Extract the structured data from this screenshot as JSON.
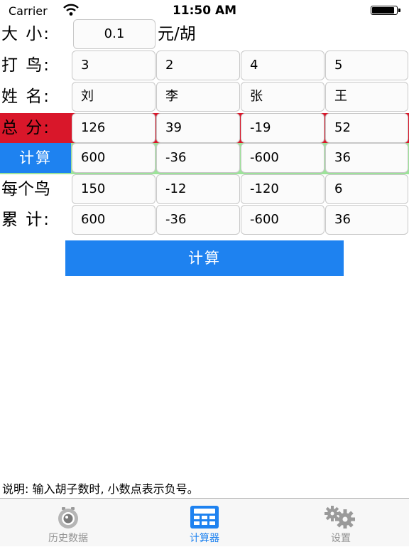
{
  "status_bar": {
    "carrier": "Carrier",
    "time": "11:50 AM",
    "battery_level": 0.9
  },
  "size_row": {
    "label": "大 小:",
    "value": "0.1",
    "unit": "元/胡"
  },
  "bird_row": {
    "label": "打 鸟:",
    "values": [
      "3",
      "2",
      "4",
      "5"
    ]
  },
  "name_row": {
    "label": "姓 名:",
    "values": [
      "刘",
      "李",
      "张",
      "王"
    ]
  },
  "total_row": {
    "label": "总 分:",
    "values": [
      "126",
      "39",
      "-19",
      "52"
    ]
  },
  "calc_row": {
    "button_label": "计算",
    "values": [
      "600",
      "-36",
      "-600",
      "36"
    ]
  },
  "per_bird_row": {
    "label": "每个鸟",
    "values": [
      "150",
      "-12",
      "-120",
      "6"
    ]
  },
  "cumulative_row": {
    "label": "累 计:",
    "values": [
      "600",
      "-36",
      "-600",
      "36"
    ]
  },
  "calculate_button": {
    "label": "计算"
  },
  "note": "说明: 输入胡子数时, 小数点表示负号。",
  "tabbar": {
    "tabs": [
      {
        "label": "历史数据",
        "icon": "camera-icon",
        "active": false
      },
      {
        "label": "计算器",
        "icon": "calculator-icon",
        "active": true
      },
      {
        "label": "设置",
        "icon": "gear-icon",
        "active": false
      }
    ]
  },
  "colors": {
    "accent": "#1e82f0",
    "total_band": "#d9172a",
    "result_band": "#9de39a",
    "inactive_tab": "#929292"
  }
}
